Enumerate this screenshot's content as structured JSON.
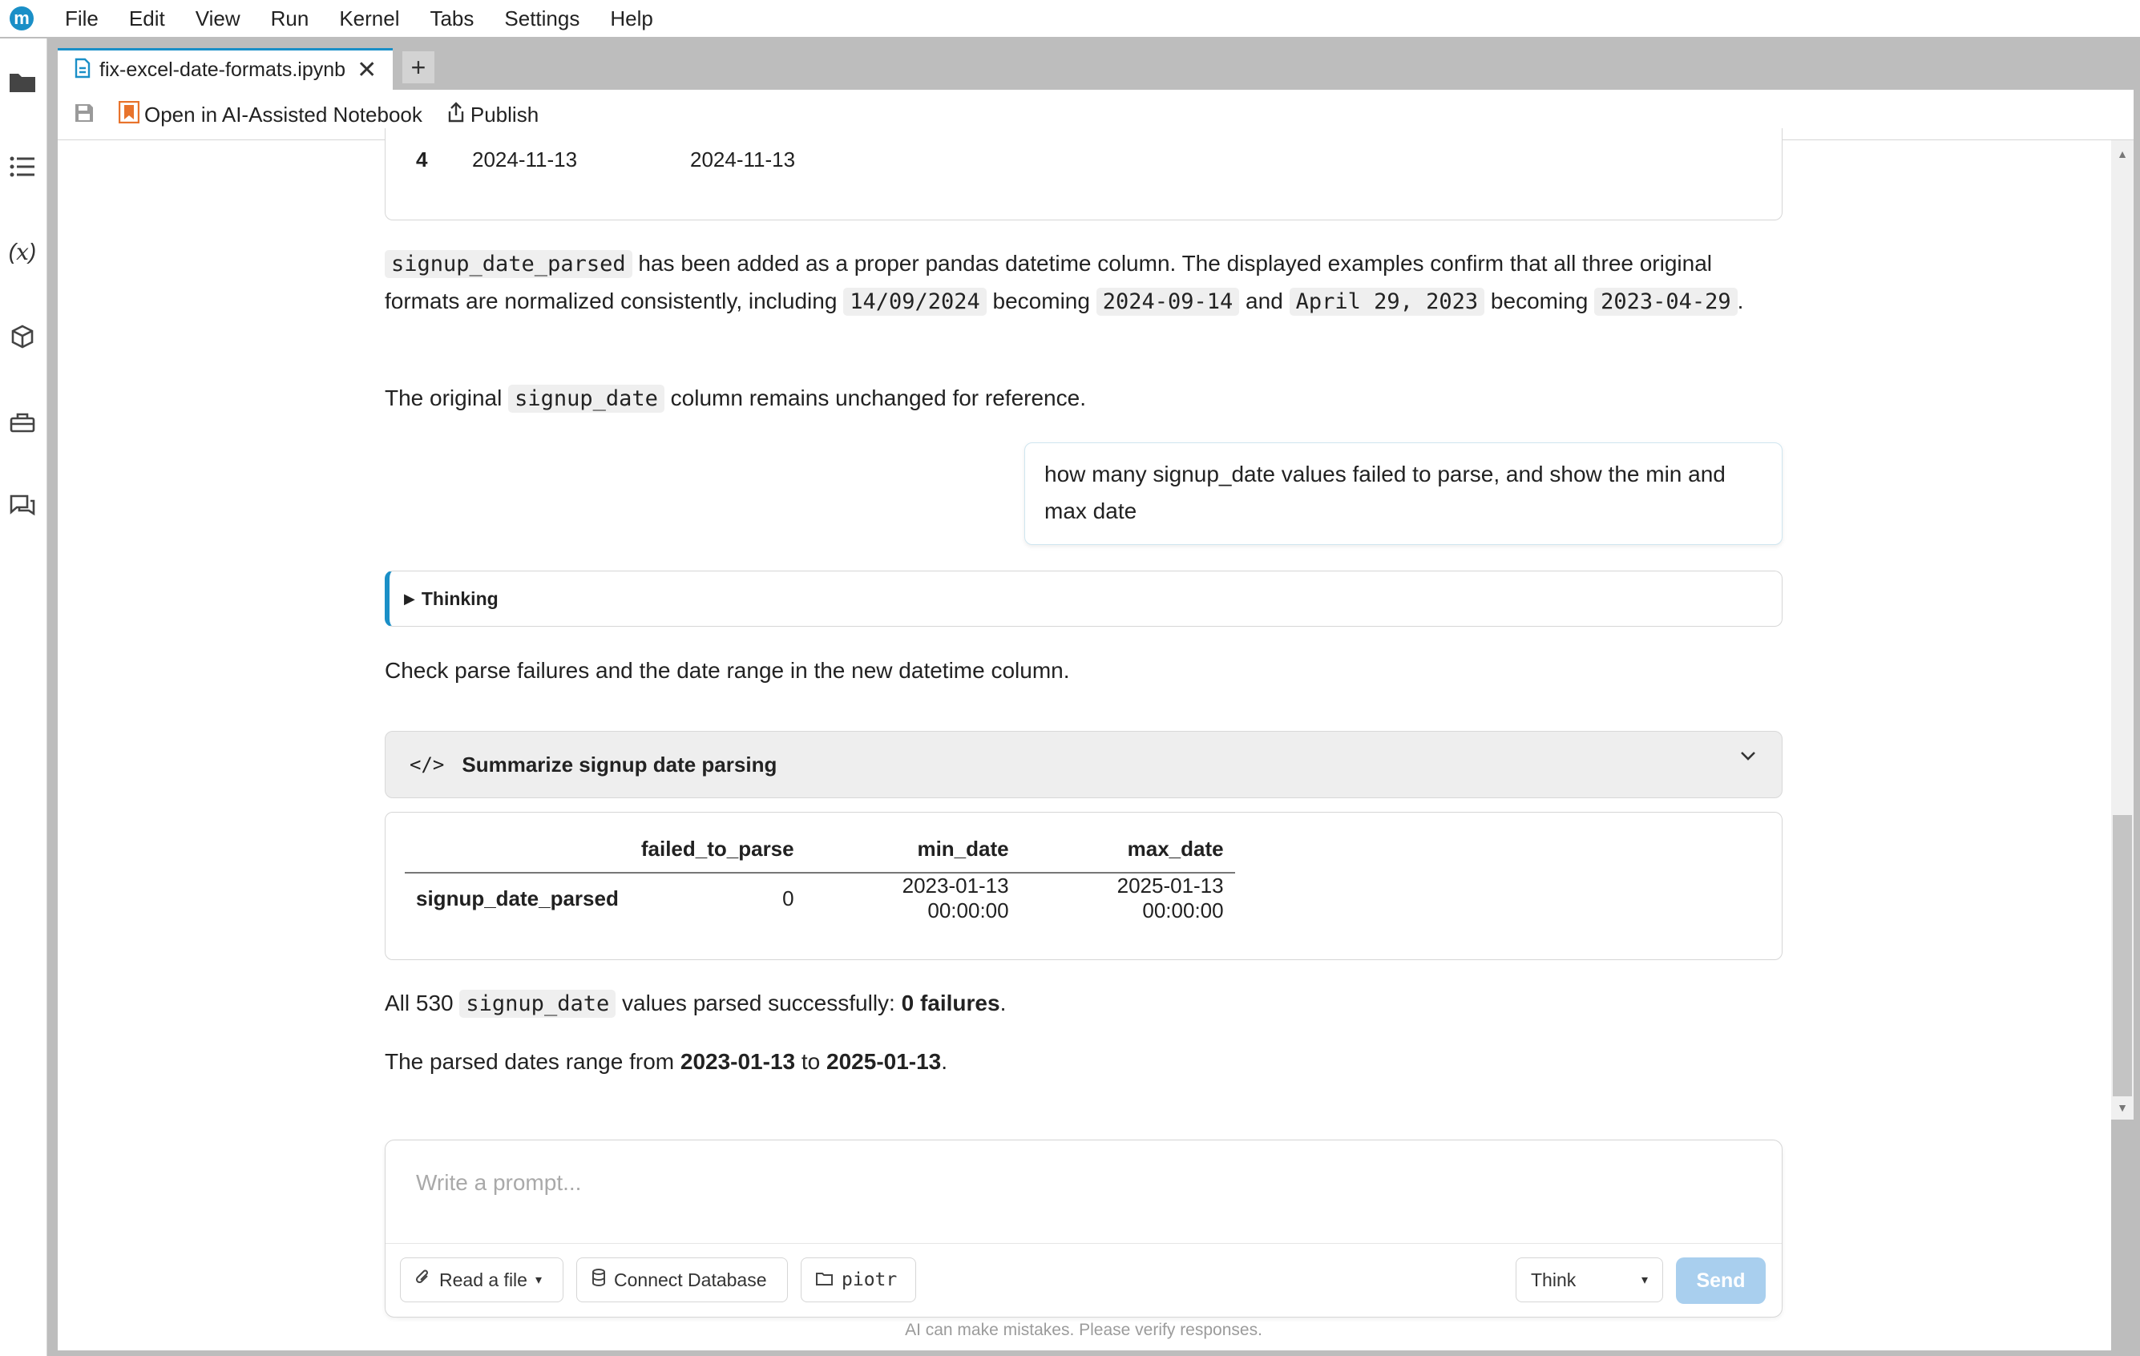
{
  "menubar": {
    "logo": "m",
    "items": [
      "File",
      "Edit",
      "View",
      "Run",
      "Kernel",
      "Tabs",
      "Settings",
      "Help"
    ]
  },
  "tabs": {
    "active_label": "fix-excel-date-formats.ipynb",
    "close_glyph": "✕",
    "add_glyph": "+"
  },
  "toolbar": {
    "open_label": "Open in AI-Assisted Notebook",
    "publish_label": "Publish"
  },
  "prev_table": {
    "index": "4",
    "col1": "2024-11-13",
    "col2": "2024-11-13"
  },
  "msg1": {
    "code_a": "signup_date_parsed",
    "text_a": " has been added as a proper pandas datetime column. The displayed examples confirm that all three original formats are normalized consistently, including ",
    "code_b": "14/09/2024",
    "text_b": " becoming ",
    "code_c": "2024-09-14",
    "text_c": " and ",
    "code_d": "April 29, 2023",
    "text_d": " becoming ",
    "code_e": "2023-04-29",
    "text_e": "."
  },
  "msg2": {
    "text_a": "The original ",
    "code_a": "signup_date",
    "text_b": " column remains unchanged for reference."
  },
  "user_message": "how many signup_date values failed to parse, and show the min and max date",
  "thinking": {
    "arrow": "▶",
    "label": "Thinking"
  },
  "msg3": "Check parse failures and the date range in the new datetime column.",
  "code_cell": {
    "icon": "</>",
    "title": "Summarize signup date parsing",
    "chevron": "⌄"
  },
  "result_table": {
    "headers": [
      "failed_to_parse",
      "min_date",
      "max_date"
    ],
    "row": {
      "index": "signup_date_parsed",
      "failed_to_parse": "0",
      "min_date": "2023-01-13 00:00:00",
      "max_date": "2025-01-13 00:00:00"
    }
  },
  "msg4": {
    "text_a": "All 530 ",
    "code_a": "signup_date",
    "text_b": " values parsed successfully: ",
    "bold_a": "0 failures",
    "text_c": "."
  },
  "msg5": {
    "text_a": "The parsed dates range from ",
    "bold_a": "2023-01-13",
    "text_b": " to ",
    "bold_b": "2025-01-13",
    "text_c": "."
  },
  "prompt": {
    "placeholder": "Write a prompt...",
    "read_file_label": "Read a file",
    "read_file_caret": "▾",
    "connect_db_label": "Connect Database",
    "folder_label": "piotr",
    "mode_value": "Think",
    "mode_caret": "▾",
    "send_label": "Send"
  },
  "disclaimer": "AI can make mistakes. Please verify responses.",
  "colors": {
    "accent": "#1a8fc7",
    "send_button": "#a9cfee",
    "chrome_gray": "#bdbdbd",
    "bookmark_orange": "#e8732c"
  }
}
